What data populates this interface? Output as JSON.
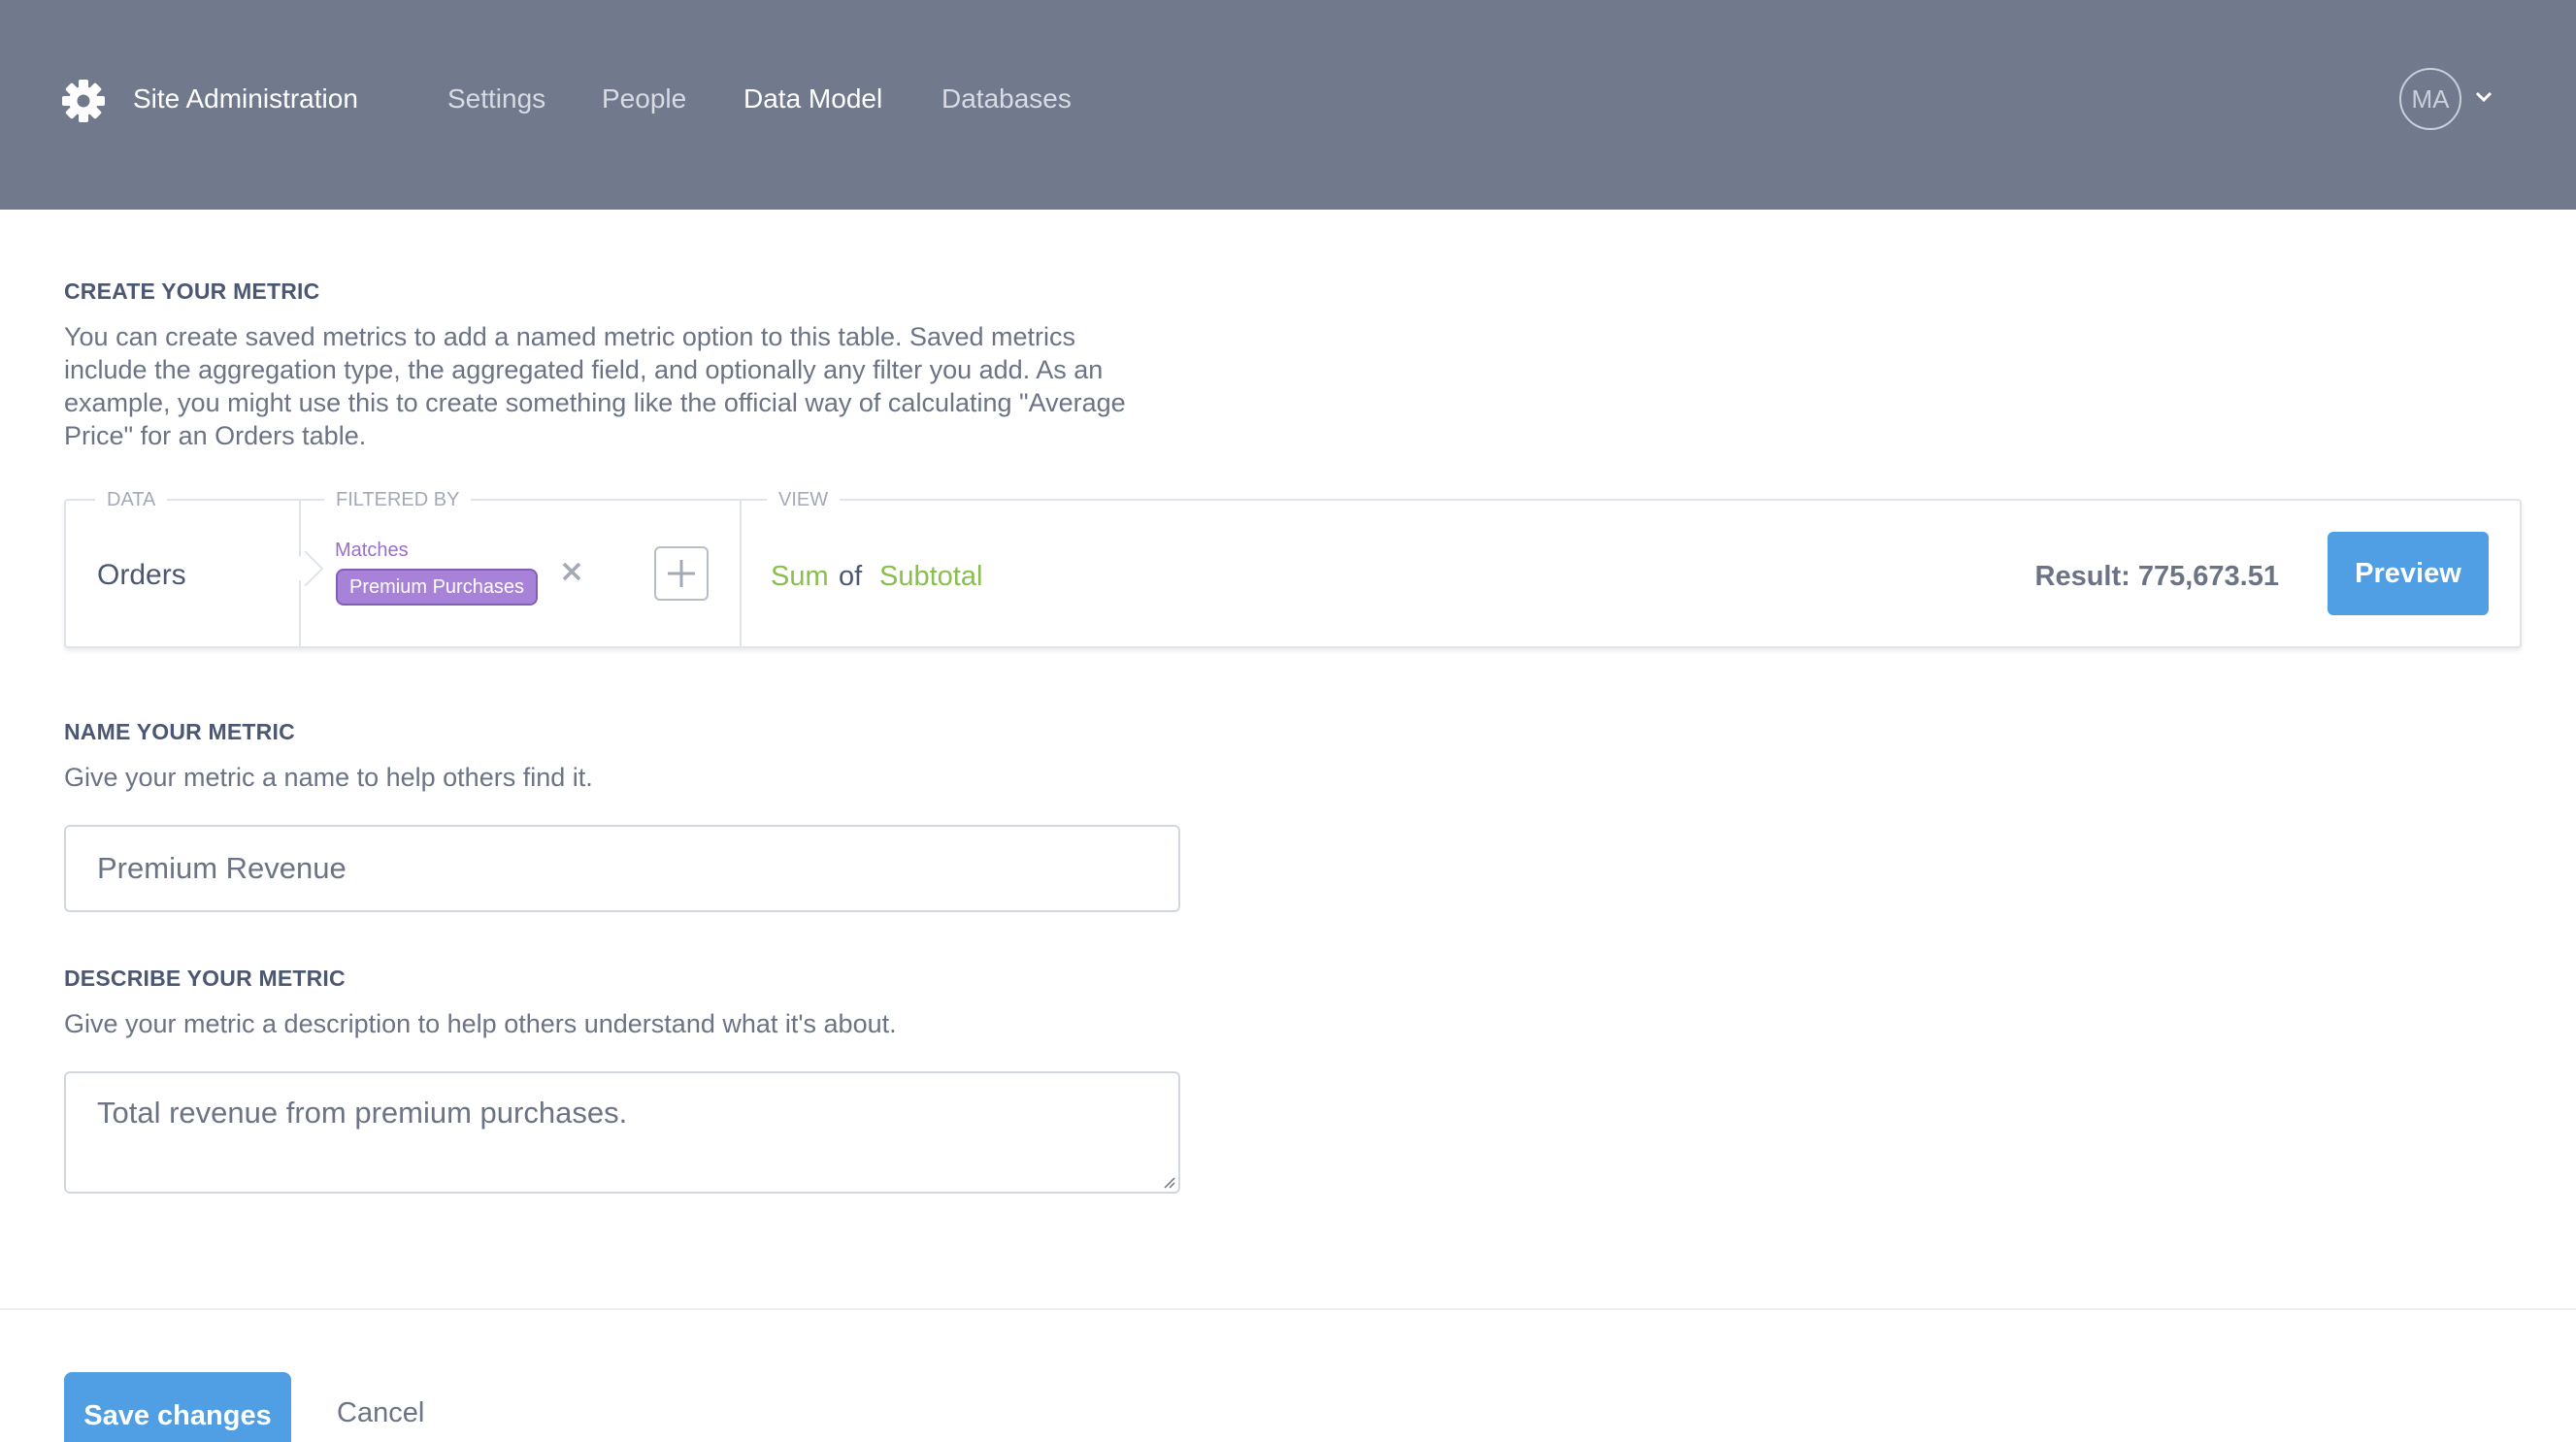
{
  "header": {
    "brand": "Site Administration",
    "nav": [
      "Settings",
      "People",
      "Data Model",
      "Databases"
    ],
    "active_nav": "Data Model",
    "avatar": "MA",
    "icons": [
      "gear-icon",
      "chevron-down-icon"
    ]
  },
  "create": {
    "title": "CREATE YOUR METRIC",
    "description_lines": [
      "You can create saved metrics to add a named metric option to this table. Saved metrics",
      "include the aggregation type, the aggregated field, and optionally any filter you add. As an",
      "example, you might use this to create something like the official way of calculating \"Average",
      "Price\" for an Orders table."
    ]
  },
  "builder": {
    "data_label": "DATA",
    "data_value": "Orders",
    "filter_label": "FILTERED BY",
    "filter_op": "Matches",
    "filter_value": "Premium Purchases",
    "view_label": "VIEW",
    "aggregation": "Sum",
    "of": "of",
    "field": "Subtotal",
    "result": "Result: 775,673.51",
    "preview": "Preview"
  },
  "name": {
    "title": "NAME YOUR METRIC",
    "description": "Give your metric a name to help others find it.",
    "value": "Premium Revenue"
  },
  "describe": {
    "title": "DESCRIBE YOUR METRIC",
    "description": "Give your metric a description to help others understand what it's about.",
    "value": "Total revenue from premium purchases."
  },
  "footer": {
    "save": "Save changes",
    "cancel": "Cancel"
  },
  "colors": {
    "header_bg": "#717a8c",
    "accent": "#509ee3",
    "filter": "#a882d9",
    "aggregation": "#88bf4d"
  }
}
